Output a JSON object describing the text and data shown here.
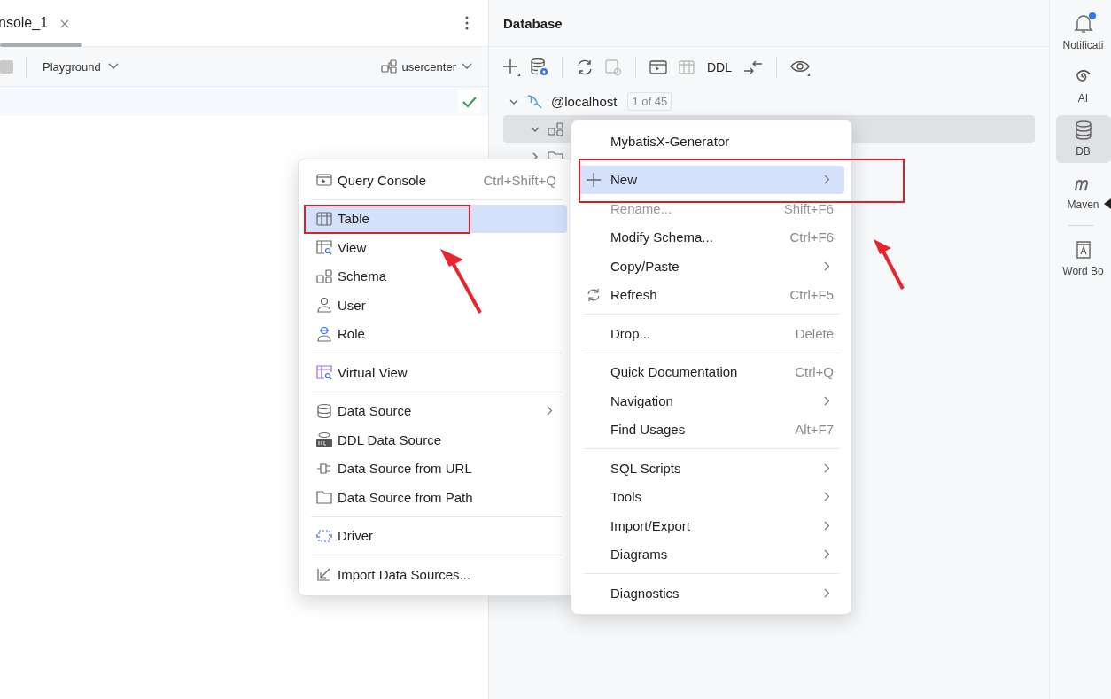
{
  "editor": {
    "tab": {
      "label": "nsole_1"
    },
    "toolbar": {
      "session": "Playground",
      "schema": "usercenter"
    }
  },
  "database": {
    "title": "Database",
    "toolbar": {
      "ddl_label": "DDL"
    },
    "tree": {
      "label": "@localhost",
      "badge": "1 of 45",
      "expanded": true,
      "children": [
        {
          "expanded": true,
          "selected": true
        },
        {
          "expanded": false,
          "selected": false
        }
      ]
    }
  },
  "new_submenu": {
    "items": [
      {
        "kind": "console",
        "label": "Query Console",
        "shortcut": "Ctrl+Shift+Q",
        "submenu": false,
        "selected": false,
        "disabled": false
      },
      {
        "kind": "separator"
      },
      {
        "kind": "table",
        "label": "Table",
        "submenu": false,
        "selected": true,
        "disabled": false
      },
      {
        "kind": "view",
        "label": "View",
        "submenu": false,
        "selected": false,
        "disabled": false
      },
      {
        "kind": "schema",
        "label": "Schema",
        "submenu": false,
        "selected": false,
        "disabled": false
      },
      {
        "kind": "user",
        "label": "User",
        "submenu": false,
        "selected": false,
        "disabled": false
      },
      {
        "kind": "role",
        "label": "Role",
        "submenu": false,
        "selected": false,
        "disabled": false
      },
      {
        "kind": "separator"
      },
      {
        "kind": "virtual",
        "label": "Virtual View",
        "submenu": false,
        "selected": false,
        "disabled": false
      },
      {
        "kind": "separator"
      },
      {
        "kind": "datasource",
        "label": "Data Source",
        "submenu": true,
        "selected": false,
        "disabled": false
      },
      {
        "kind": "ddl",
        "label": "DDL Data Source",
        "submenu": false,
        "selected": false,
        "disabled": false
      },
      {
        "kind": "url",
        "label": "Data Source from URL",
        "submenu": false,
        "selected": false,
        "disabled": false
      },
      {
        "kind": "folder",
        "label": "Data Source from Path",
        "submenu": false,
        "selected": false,
        "disabled": false
      },
      {
        "kind": "separator"
      },
      {
        "kind": "driver",
        "label": "Driver",
        "submenu": false,
        "selected": false,
        "disabled": false
      },
      {
        "kind": "separator"
      },
      {
        "kind": "import",
        "label": "Import Data Sources...",
        "submenu": false,
        "selected": false,
        "disabled": false
      }
    ]
  },
  "context_menu": {
    "items": [
      {
        "kind": "item",
        "label": "MybatisX-Generator",
        "submenu": false,
        "selected": false,
        "disabled": false
      },
      {
        "kind": "gap"
      },
      {
        "kind": "plus",
        "label": "New",
        "submenu": true,
        "selected": true,
        "disabled": false
      },
      {
        "kind": "item",
        "label": "Rename...",
        "shortcut": "Shift+F6",
        "submenu": false,
        "selected": false,
        "disabled": true
      },
      {
        "kind": "item",
        "label": "Modify Schema...",
        "shortcut": "Ctrl+F6",
        "submenu": false,
        "selected": false,
        "disabled": false
      },
      {
        "kind": "item",
        "label": "Copy/Paste",
        "submenu": true,
        "selected": false,
        "disabled": false
      },
      {
        "kind": "refresh",
        "label": "Refresh",
        "shortcut": "Ctrl+F5",
        "submenu": false,
        "selected": false,
        "disabled": false
      },
      {
        "kind": "separator"
      },
      {
        "kind": "item",
        "label": "Drop...",
        "shortcut": "Delete",
        "submenu": false,
        "selected": false,
        "disabled": false
      },
      {
        "kind": "separator"
      },
      {
        "kind": "item",
        "label": "Quick Documentation",
        "shortcut": "Ctrl+Q",
        "submenu": false,
        "selected": false,
        "disabled": false
      },
      {
        "kind": "item",
        "label": "Navigation",
        "submenu": true,
        "selected": false,
        "disabled": false
      },
      {
        "kind": "item",
        "label": "Find Usages",
        "shortcut": "Alt+F7",
        "submenu": false,
        "selected": false,
        "disabled": false
      },
      {
        "kind": "separator"
      },
      {
        "kind": "item",
        "label": "SQL Scripts",
        "submenu": true,
        "selected": false,
        "disabled": false
      },
      {
        "kind": "item",
        "label": "Tools",
        "submenu": true,
        "selected": false,
        "disabled": false
      },
      {
        "kind": "item",
        "label": "Import/Export",
        "submenu": true,
        "selected": false,
        "disabled": false
      },
      {
        "kind": "item",
        "label": "Diagrams",
        "submenu": true,
        "selected": false,
        "disabled": false
      },
      {
        "kind": "separator"
      },
      {
        "kind": "item",
        "label": "Diagnostics",
        "submenu": true,
        "selected": false,
        "disabled": false
      }
    ]
  },
  "sidebar": {
    "items": [
      {
        "kind": "bell",
        "label": "Notificati",
        "notification": true,
        "selected": false
      },
      {
        "kind": "spiral",
        "label": "AI",
        "notification": false,
        "selected": false
      },
      {
        "kind": "database",
        "label": "DB",
        "notification": false,
        "selected": true
      },
      {
        "kind": "maven",
        "label": "Maven",
        "notification": false,
        "selected": false
      },
      {
        "kind": "separator"
      },
      {
        "kind": "book",
        "label": "Word Bo",
        "notification": false,
        "selected": false
      }
    ]
  }
}
